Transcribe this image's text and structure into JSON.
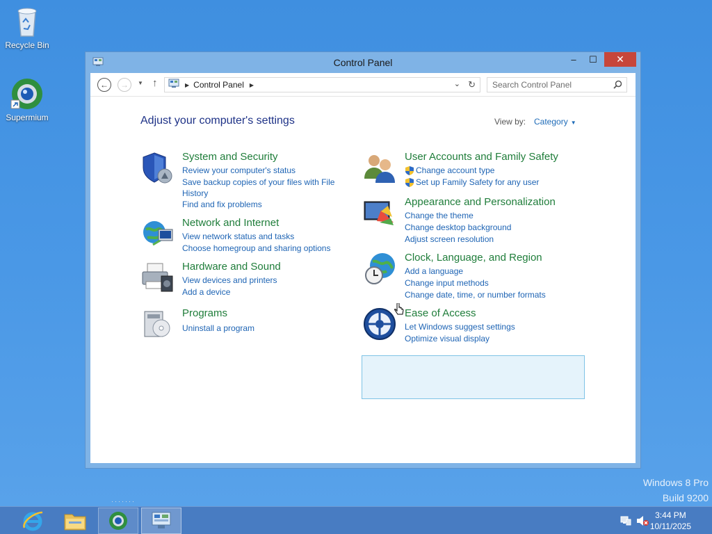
{
  "desktop": {
    "icons": [
      {
        "label": "Recycle Bin",
        "icon": "recycle-bin-icon"
      },
      {
        "label": "Supermium",
        "icon": "supermium-icon"
      }
    ],
    "watermark": {
      "line1": "Windows 8 Pro",
      "line2": "Build 9200"
    }
  },
  "window": {
    "title": "Control Panel",
    "buttons": {
      "minimize": "‒",
      "maximize": "☐",
      "close": "✕"
    },
    "address": {
      "crumb": "Control Panel"
    },
    "search": {
      "placeholder": "Search Control Panel"
    },
    "heading": "Adjust your computer's settings",
    "view_by_label": "View by:",
    "view_by_value": "Category",
    "categories": [
      {
        "title": "System and Security",
        "icon": "shield-icon",
        "links": [
          "Review your computer's status",
          "Save backup copies of your files with File History",
          "Find and fix problems"
        ]
      },
      {
        "title": "Network and Internet",
        "icon": "network-icon",
        "links": [
          "View network status and tasks",
          "Choose homegroup and sharing options"
        ]
      },
      {
        "title": "Hardware and Sound",
        "icon": "printer-icon",
        "links": [
          "View devices and printers",
          "Add a device"
        ]
      },
      {
        "title": "Programs",
        "icon": "programs-icon",
        "links": [
          "Uninstall a program"
        ]
      },
      {
        "title": "User Accounts and Family Safety",
        "icon": "users-icon",
        "links": [
          "Change account type",
          "Set up Family Safety for any user"
        ]
      },
      {
        "title": "Appearance and Personalization",
        "icon": "display-icon",
        "links": [
          "Change the theme",
          "Change desktop background",
          "Adjust screen resolution"
        ]
      },
      {
        "title": "Clock, Language, and Region",
        "icon": "globe-clock-icon",
        "links": [
          "Add a language",
          "Change input methods",
          "Change date, time, or number formats"
        ]
      },
      {
        "title": "Ease of Access",
        "icon": "ease-of-access-icon",
        "links": [
          "Let Windows suggest settings",
          "Optimize visual display"
        ]
      }
    ]
  },
  "taskbar": {
    "items": [
      "internet-explorer-icon",
      "file-explorer-icon",
      "supermium-icon",
      "control-panel-icon"
    ],
    "clock": {
      "time": "3:44 PM",
      "date": "10/11/2025"
    }
  },
  "colors": {
    "category_title": "#1f7d3a",
    "link": "#1e64b4",
    "heading": "#1e3287",
    "close": "#c7463a"
  }
}
